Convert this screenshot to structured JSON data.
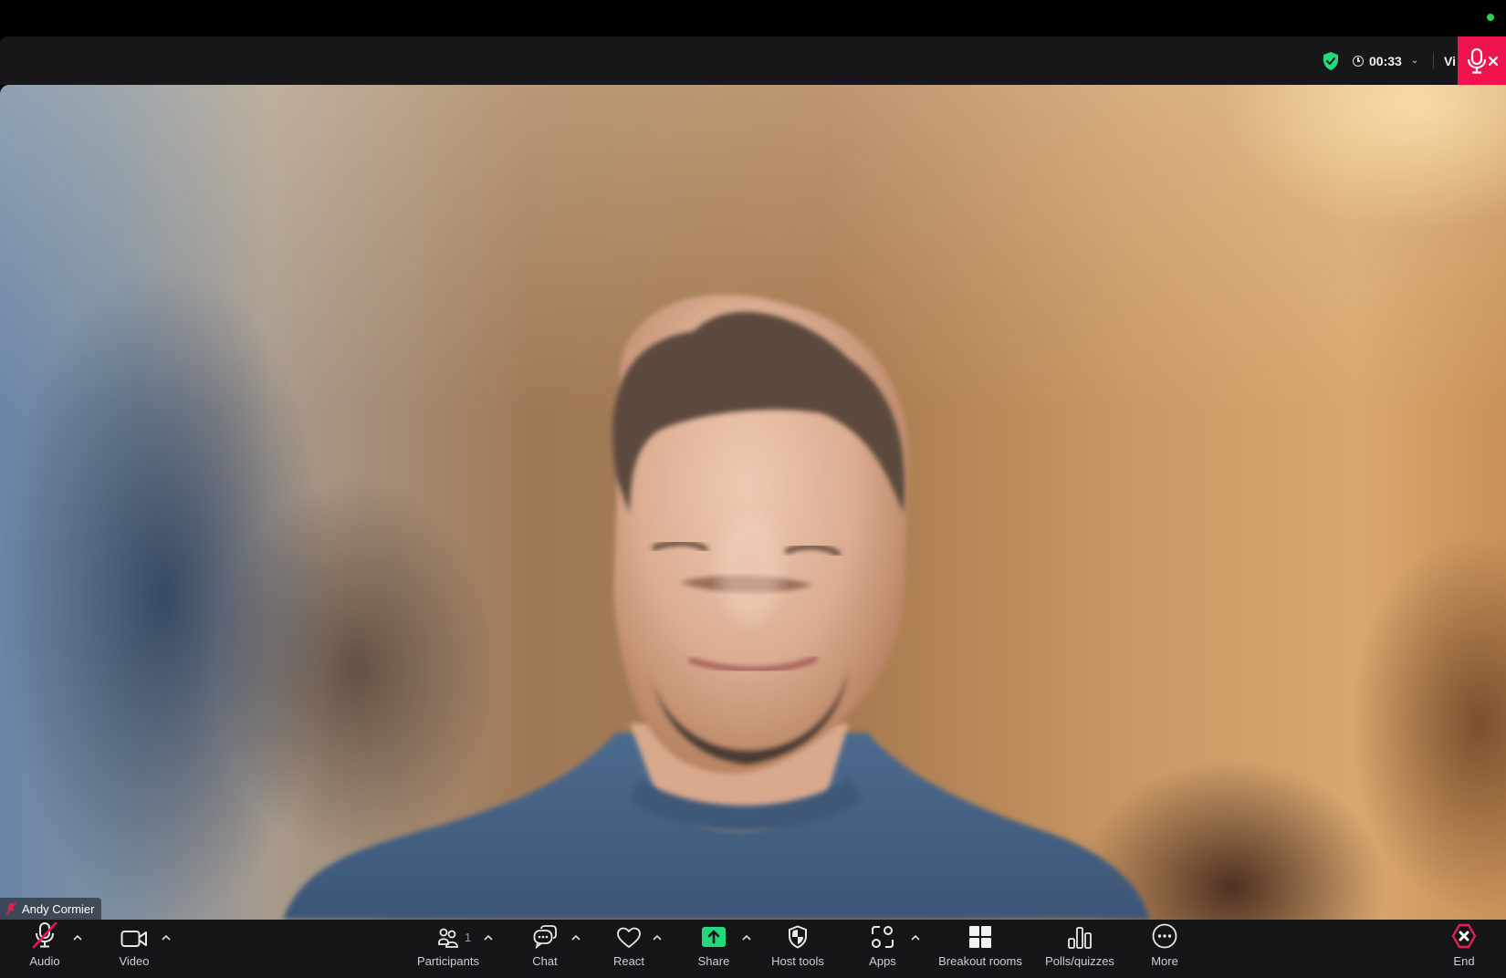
{
  "header": {
    "encryption_icon": "shield-check-icon",
    "timer": "00:33",
    "view_label": "Vi",
    "muted_icon": "mic-muted-icon"
  },
  "video": {
    "participant_name": "Andy Cormier",
    "participant_muted": true
  },
  "toolbar": {
    "audio_label": "Audio",
    "video_label": "Video",
    "participants_label": "Participants",
    "participants_count": "1",
    "chat_label": "Chat",
    "react_label": "React",
    "share_label": "Share",
    "host_tools_label": "Host tools",
    "apps_label": "Apps",
    "breakout_label": "Breakout rooms",
    "polls_label": "Polls/quizzes",
    "more_label": "More",
    "end_label": "End"
  },
  "colors": {
    "accent_green": "#23d97c",
    "muted_red": "#f0134d",
    "toolbar_bg": "#151518",
    "header_bg": "#17171a"
  }
}
